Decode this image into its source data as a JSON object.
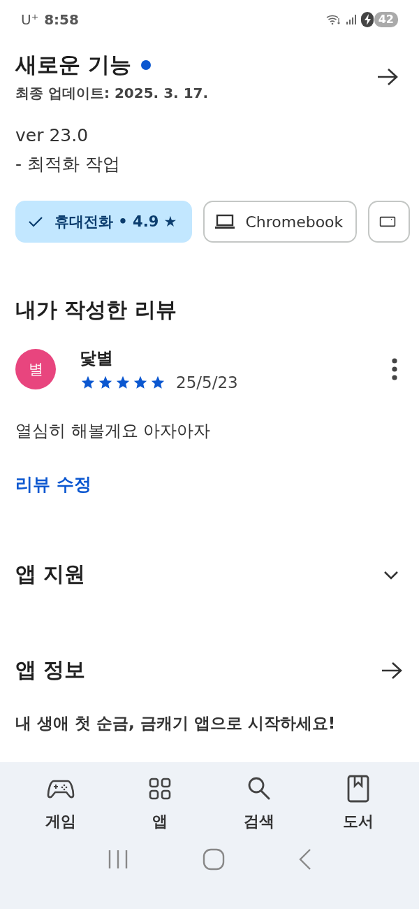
{
  "status_bar": {
    "carrier": "U⁺",
    "time": "8:58",
    "battery": "42"
  },
  "whats_new": {
    "title": "새로운 기능",
    "subtitle": "최종 업데이트: 2025. 3. 17.",
    "lines": [
      "ver 23.0",
      "- 최적화 작업"
    ]
  },
  "device_chips": [
    {
      "kind": "phone",
      "label": "휴대전화 • 4.9 ★",
      "selected": true
    },
    {
      "kind": "laptop",
      "label": "Chromebook",
      "selected": false
    },
    {
      "kind": "tablet",
      "selected": false
    }
  ],
  "my_review": {
    "heading": "내가 작성한 리뷰",
    "avatar": "별",
    "author": "닻별",
    "stars": 5,
    "date": "25/5/23",
    "text": "열심히 해볼게요 아자아자",
    "edit_link": "리뷰 수정"
  },
  "sections": [
    {
      "kind": "expand",
      "title": "앱 지원"
    },
    {
      "kind": "arrow",
      "title": "앱 정보"
    }
  ],
  "promo": "내 생애 첫 순금, 금캐기 앱으로 시작하세요!",
  "bottom_nav": [
    {
      "kind": "games",
      "label": "게임"
    },
    {
      "kind": "apps",
      "label": "앱"
    },
    {
      "kind": "search",
      "label": "검색"
    },
    {
      "kind": "books",
      "label": "도서"
    }
  ]
}
